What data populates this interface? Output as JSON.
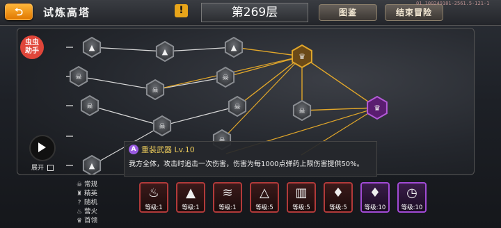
{
  "header": {
    "back_symbol": "⮌",
    "title": "试炼高塔",
    "alert_symbol": "!",
    "floor": "第269层",
    "atlas_label": "图鉴",
    "end_label": "结束冒险",
    "version": "01_100249181-2561.5-121-1"
  },
  "map": {
    "accent_color": "#e2a72a",
    "boss_color": "#7b2b9a",
    "nodes": [
      {
        "type": "elite"
      },
      {
        "type": "elite"
      },
      {
        "type": "elite"
      },
      {
        "type": "normal"
      },
      {
        "type": "normal"
      },
      {
        "type": "normal"
      },
      {
        "type": "normal"
      },
      {
        "type": "normal"
      },
      {
        "type": "normal"
      },
      {
        "type": "elite"
      },
      {
        "type": "boss"
      },
      {
        "type": "boss_final"
      }
    ]
  },
  "helper": {
    "label_line1": "虫虫",
    "label_line2": "助手"
  },
  "expand_label": "展开",
  "tooltip": {
    "badge": "A",
    "title": "重装武器 Lv.10",
    "description": "我方全体，攻击时追击一次伤害，伤害为每1000点弹药上限伤害提供50%。"
  },
  "legend": [
    {
      "icon": "skull-icon",
      "label": "常规"
    },
    {
      "icon": "elite-icon",
      "label": "精英"
    },
    {
      "icon": "question-icon",
      "label": "随机"
    },
    {
      "icon": "fire-icon",
      "label": "营火"
    },
    {
      "icon": "boss-icon",
      "label": "首领"
    }
  ],
  "skills": [
    {
      "icon": "flame-skill-icon",
      "level_label": "等级:1",
      "rarity": "red"
    },
    {
      "icon": "drop-skill-icon",
      "level_label": "等级:1",
      "rarity": "red"
    },
    {
      "icon": "rank-skill-icon",
      "level_label": "等级:1",
      "rarity": "red"
    },
    {
      "icon": "triangle-skill-icon",
      "level_label": "等级:5",
      "rarity": "red"
    },
    {
      "icon": "wall-skill-icon",
      "level_label": "等级:5",
      "rarity": "red"
    },
    {
      "icon": "crystal-skill-icon",
      "level_label": "等级:5",
      "rarity": "red"
    },
    {
      "icon": "crystal2-skill-icon",
      "level_label": "等级:10",
      "rarity": "purple"
    },
    {
      "icon": "clock-skill-icon",
      "level_label": "等级:10",
      "rarity": "purple"
    }
  ]
}
